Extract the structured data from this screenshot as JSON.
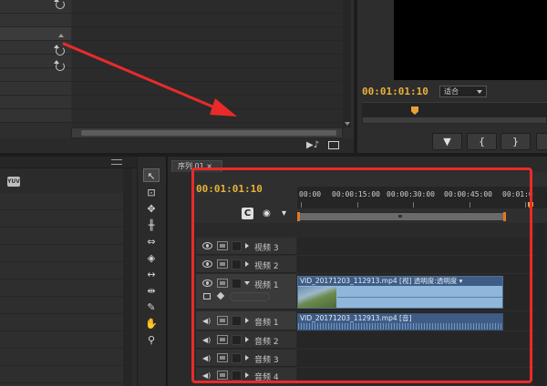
{
  "program_monitor": {
    "timecode": "00:01:01:10",
    "zoom_value": "适合",
    "buttons": [
      "▼",
      "{",
      "}"
    ]
  },
  "project_panel": {
    "thumb_icon_label": "YUV"
  },
  "timeline": {
    "tab_label": "序列 01 ×",
    "timecode": "00:01:01:10",
    "ruler_labels": [
      "00:00",
      "00:00:15:00",
      "00:00:30:00",
      "00:00:45:00",
      "00:01:0"
    ],
    "tracks": [
      {
        "name": "视频 3",
        "kind": "video"
      },
      {
        "name": "视频 2",
        "kind": "video"
      },
      {
        "name": "视频 1",
        "kind": "video"
      },
      {
        "name": "音频 1",
        "kind": "audio"
      },
      {
        "name": "音频 2",
        "kind": "audio"
      },
      {
        "name": "音频 3",
        "kind": "audio"
      },
      {
        "name": "音频 4",
        "kind": "audio"
      }
    ],
    "video_clip_title": "VID_20171203_112913.mp4 [视] 透明度:透明度 ▾",
    "audio_clip_title": "VID_20171203_112913.mp4 [音]"
  },
  "icons": {
    "selection_tool": "arrow-cursor-icon",
    "snap": "snap-magnet-icon",
    "marker": "marker-icon",
    "reset": "reset-icon"
  },
  "colors": {
    "timecode": "#e8b23a",
    "annotation": "#ea2a2a",
    "video_clip": "#8fb7dc",
    "audio_clip": "#5c80ad"
  }
}
